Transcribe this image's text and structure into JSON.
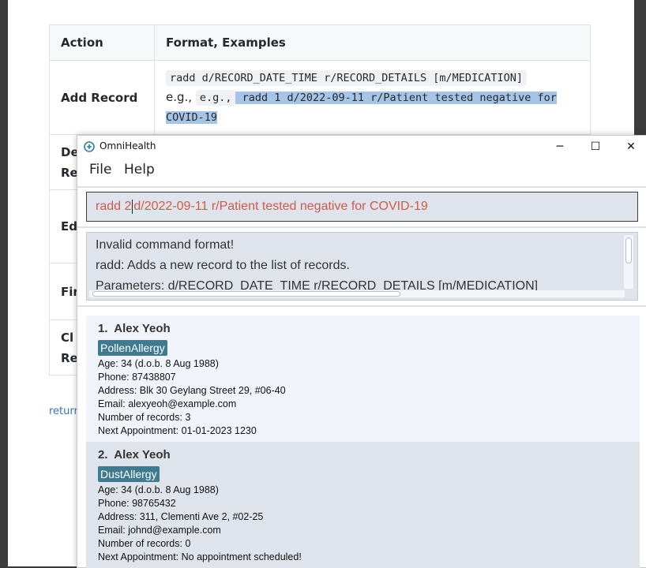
{
  "doc_table": {
    "headers": [
      "Action",
      "Format, Examples"
    ],
    "row1": {
      "action": "Add Record",
      "format_code": "radd d/RECORD_DATE_TIME r/RECORD_DETAILS [m/MEDICATION]",
      "eg1": "e.g.,",
      "eg2": "e.g.,",
      "example_line1": " radd 1 d/2022-09-11 r/Patient tested negative for",
      "example_line2": "COVID-19"
    },
    "partial_rows": [
      "De",
      "Re",
      "Ed",
      "Fir",
      "Cl",
      "Re"
    ]
  },
  "return_link": "return",
  "window": {
    "title": "OmniHealth",
    "controls": {
      "minimize": "─",
      "maximize": "☐",
      "close": "✕"
    },
    "menu": [
      "File",
      "Help"
    ],
    "command": {
      "before_caret": "radd 2",
      "after_caret": "d/2022-09-11 r/Patient tested negative for COVID-19"
    },
    "result": {
      "lines": [
        "Invalid command format!",
        "radd: Adds a new record to the list of records.",
        "Parameters: d/RECORD_DATE_TIME r/RECORD_DETAILS [m/MEDICATION]"
      ]
    },
    "patients": [
      {
        "index": "1.",
        "name": "Alex Yeoh",
        "tag": "PollenAllergy",
        "age": "Age: 34   (d.o.b. 8 Aug 1988)",
        "phone": "Phone: 87438807",
        "address": "Address: Blk 30 Geylang Street 29, #06-40",
        "email": "Email: alexyeoh@example.com",
        "records": "Number of records: 3",
        "appointment": "Next Appointment: 01-01-2023 1230",
        "background": "#f1f4fa"
      },
      {
        "index": "2.",
        "name": "Alex Yeoh",
        "tag": "DustAllergy",
        "age": "Age: 34   (d.o.b. 8 Aug 1988)",
        "phone": "Phone: 98765432",
        "address": "Address: 311, Clementi Ave 2, #02-25",
        "email": "Email: johnd@example.com",
        "records": "Number of records: 0",
        "appointment": "Next Appointment: No appointment scheduled!",
        "background": "#dfe3ec"
      }
    ]
  },
  "colors": {
    "tag": "#3e7b91",
    "command_text": "#d05a4a",
    "selection": "#a6c5e6"
  }
}
